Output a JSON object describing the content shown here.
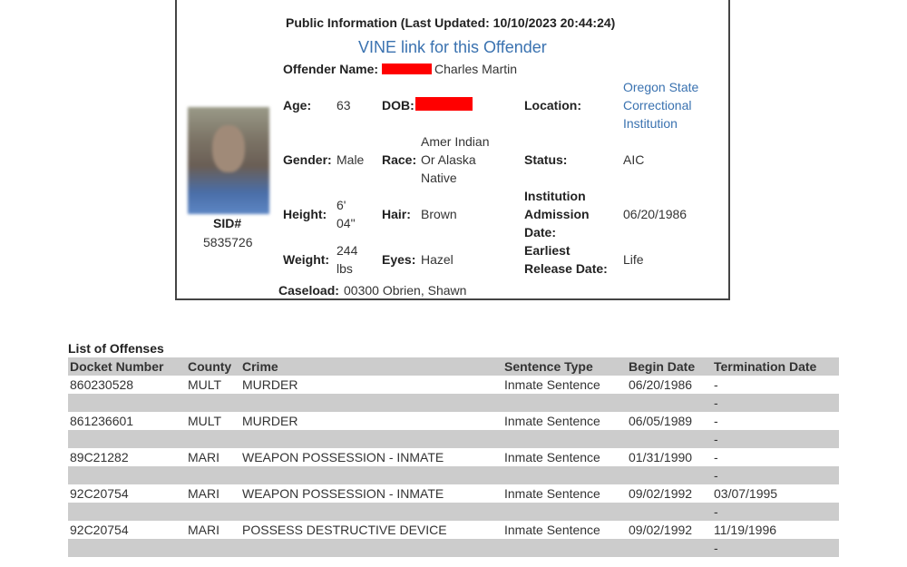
{
  "public_info": {
    "updated_text": "Public Information (Last Updated: 10/10/2023 20:44:24)",
    "vine_link": "VINE link for this Offender",
    "offender_name_label": "Offender Name:",
    "offender_name": "Charles Martin",
    "redaction_color": "#ff0000",
    "sid_label": "SID#",
    "sid": "5835726",
    "fields": {
      "age_label": "Age:",
      "age": "63",
      "dob_label": "DOB:",
      "location_label": "Location:",
      "location_line1": "Oregon State",
      "location_line2": "Correctional",
      "location_line3": "Institution",
      "gender_label": "Gender:",
      "gender": "Male",
      "race_label": "Race:",
      "race_line1": "Amer Indian",
      "race_line2": "Or Alaska",
      "race_line3": "Native",
      "status_label": "Status:",
      "status": "AIC",
      "height_label": "Height:",
      "height_line1": "6'",
      "height_line2": "04\"",
      "hair_label": "Hair:",
      "hair": "Brown",
      "admission_label_line1": "Institution",
      "admission_label_line2": "Admission",
      "admission_label_line3": "Date:",
      "admission_date": "06/20/1986",
      "weight_label": "Weight:",
      "weight_line1": "244",
      "weight_line2": "lbs",
      "eyes_label": "Eyes:",
      "eyes": "Hazel",
      "release_label_line1": "Earliest",
      "release_label_line2": "Release Date:",
      "release_date": "Life",
      "caseload_label": "Caseload:",
      "caseload": "00300 Obrien, Shawn"
    }
  },
  "offenses": {
    "title": "List of Offenses",
    "headers": [
      "Docket Number",
      "County",
      "Crime",
      "Sentence Type",
      "Begin Date",
      "Termination Date"
    ],
    "rows": [
      {
        "docket": "860230528",
        "county": "MULT",
        "crime": "MURDER",
        "sentence_type": "Inmate Sentence",
        "begin": "06/20/1986",
        "termination": "-",
        "sub_termination": "-"
      },
      {
        "docket": "861236601",
        "county": "MULT",
        "crime": "MURDER",
        "sentence_type": "Inmate Sentence",
        "begin": "06/05/1989",
        "termination": "-",
        "sub_termination": "-"
      },
      {
        "docket": "89C21282",
        "county": "MARI",
        "crime": "WEAPON POSSESSION - INMATE",
        "sentence_type": "Inmate Sentence",
        "begin": "01/31/1990",
        "termination": "-",
        "sub_termination": "-"
      },
      {
        "docket": "92C20754",
        "county": "MARI",
        "crime": "WEAPON POSSESSION - INMATE",
        "sentence_type": "Inmate Sentence",
        "begin": "09/02/1992",
        "termination": "03/07/1995",
        "sub_termination": "-"
      },
      {
        "docket": "92C20754",
        "county": "MARI",
        "crime": "POSSESS DESTRUCTIVE DEVICE",
        "sentence_type": "Inmate Sentence",
        "begin": "09/02/1992",
        "termination": "11/19/1996",
        "sub_termination": "-"
      }
    ]
  }
}
